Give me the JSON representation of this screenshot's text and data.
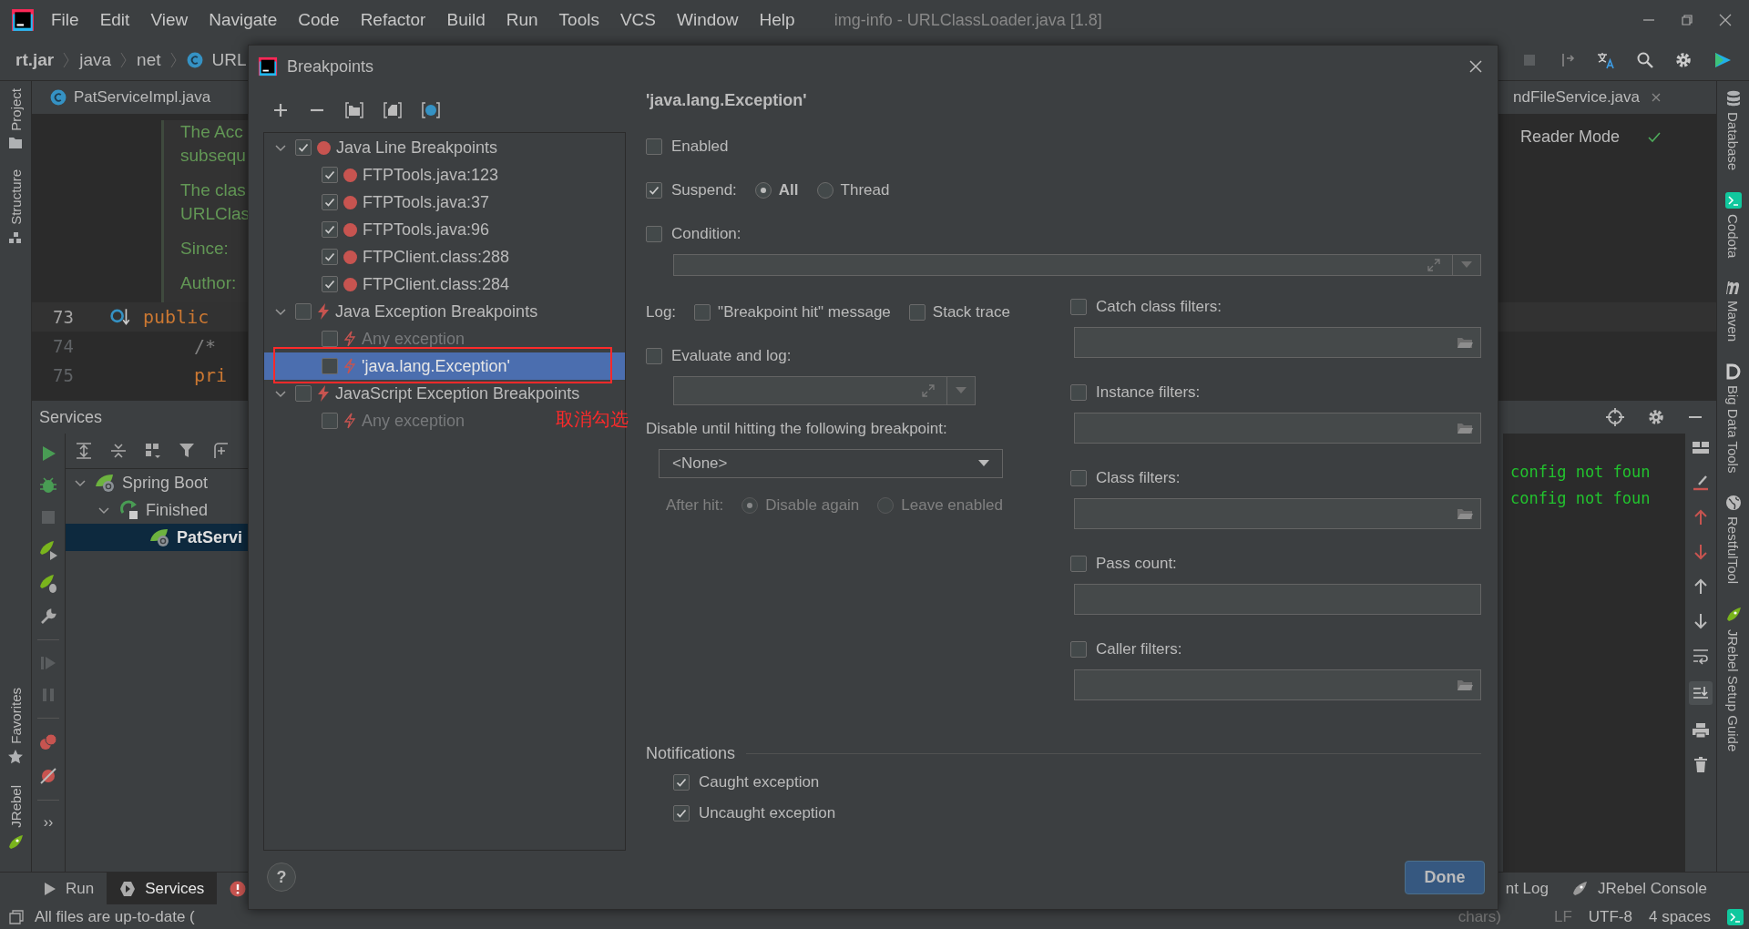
{
  "menu": [
    "File",
    "Edit",
    "View",
    "Navigate",
    "Code",
    "Refactor",
    "Build",
    "Run",
    "Tools",
    "VCS",
    "Window",
    "Help"
  ],
  "title": "img-info - URLClassLoader.java [1.8]",
  "breadcrumb": [
    "rt.jar",
    "java",
    "net",
    "URL"
  ],
  "editor_tabs": [
    "PatServiceImpl.java",
    "ndFileService.java"
  ],
  "reader_mode": "Reader Mode",
  "doc_lines": [
    "The Acc",
    "subsequ",
    "The clas",
    "URLClas",
    "Since:",
    "Author:"
  ],
  "code_lines": [
    {
      "number": "73",
      "text": "public"
    },
    {
      "number": "74",
      "text": "/*"
    },
    {
      "number": "75",
      "text": "pri"
    }
  ],
  "left_strip_top": [
    "Project",
    "Structure"
  ],
  "left_strip_bottom": [
    "Favorites",
    "JRebel"
  ],
  "more": "››",
  "right_strip": [
    "Database",
    "Codota",
    "Maven",
    "Big Data Tools",
    "RestfulTool",
    "JRebel Setup Guide"
  ],
  "services": {
    "title": "Services",
    "tree": [
      {
        "label": "Spring Boot",
        "selected": false,
        "expanded": true,
        "children": [
          {
            "label": "Finished",
            "selected": false,
            "expanded": true,
            "children": [
              {
                "label": "PatServi",
                "selected": true
              }
            ]
          }
        ]
      }
    ]
  },
  "console_lines": [
    "config not foun",
    "config not foun"
  ],
  "bottom_tabs": [
    {
      "label": "Run",
      "selected": false
    },
    {
      "label": "Services",
      "selected": true
    }
  ],
  "bottom_tabs_right": [
    "nt Log",
    "JRebel Console"
  ],
  "status": {
    "message": "All files are up-to-date (",
    "position": "chars)",
    "line_ending": "LF",
    "encoding": "UTF-8",
    "indent": "4 spaces"
  },
  "dialog": {
    "title": "Breakpoints",
    "tree": [
      {
        "label": "Java Line Breakpoints",
        "kind": "line",
        "checked": true,
        "expanded": true,
        "disabled": false,
        "selected": false,
        "children": [
          {
            "label": "FTPTools.java:123",
            "kind": "line",
            "checked": true,
            "disabled": false,
            "selected": false
          },
          {
            "label": "FTPTools.java:37",
            "kind": "line",
            "checked": true,
            "disabled": false,
            "selected": false
          },
          {
            "label": "FTPTools.java:96",
            "kind": "line",
            "checked": true,
            "disabled": false,
            "selected": false
          },
          {
            "label": "FTPClient.class:288",
            "kind": "line",
            "checked": true,
            "disabled": false,
            "selected": false
          },
          {
            "label": "FTPClient.class:284",
            "kind": "line",
            "checked": true,
            "disabled": false,
            "selected": false
          }
        ]
      },
      {
        "label": "Java Exception Breakpoints",
        "kind": "exception",
        "checked": false,
        "expanded": true,
        "disabled": false,
        "selected": false,
        "children": [
          {
            "label": "Any exception",
            "kind": "exception",
            "checked": false,
            "disabled": true,
            "selected": false
          },
          {
            "label": "'java.lang.Exception'",
            "kind": "exception",
            "checked": false,
            "disabled": false,
            "selected": true
          }
        ]
      },
      {
        "label": "JavaScript Exception Breakpoints",
        "kind": "exception",
        "checked": false,
        "expanded": true,
        "disabled": false,
        "selected": false,
        "children": [
          {
            "label": "Any exception",
            "kind": "exception",
            "checked": false,
            "disabled": true,
            "selected": false
          }
        ]
      }
    ],
    "annotation": "取消勾选",
    "heading": "'java.lang.Exception'",
    "enabled": {
      "label": "Enabled",
      "checked": false
    },
    "suspend": {
      "label": "Suspend:",
      "checked": true,
      "options": [
        {
          "label": "All",
          "selected": true
        },
        {
          "label": "Thread",
          "selected": false
        }
      ]
    },
    "condition": {
      "label": "Condition:",
      "checked": false
    },
    "log": {
      "label": "Log:",
      "options": [
        {
          "label": "\"Breakpoint hit\" message",
          "checked": false
        },
        {
          "label": "Stack trace",
          "checked": false
        }
      ]
    },
    "evaluate": {
      "label": "Evaluate and log:",
      "checked": false
    },
    "disable_until": {
      "label": "Disable until hitting the following breakpoint:",
      "value": "<None>"
    },
    "after_hit": {
      "label": "After hit:",
      "disabled": true,
      "options": [
        {
          "label": "Disable again",
          "selected": true
        },
        {
          "label": "Leave enabled",
          "selected": false
        }
      ]
    },
    "filters": [
      {
        "label": "Catch class filters:",
        "checked": false,
        "kind": "browse"
      },
      {
        "label": "Instance filters:",
        "checked": false,
        "kind": "browse"
      },
      {
        "label": "Class filters:",
        "checked": false,
        "kind": "browse"
      },
      {
        "label": "Pass count:",
        "checked": false,
        "kind": "plain"
      },
      {
        "label": "Caller filters:",
        "checked": false,
        "kind": "browse"
      }
    ],
    "notifications": {
      "title": "Notifications",
      "options": [
        {
          "label": "Caught exception",
          "checked": true
        },
        {
          "label": "Uncaught exception",
          "checked": true
        }
      ]
    },
    "help": "?",
    "done": "Done"
  }
}
